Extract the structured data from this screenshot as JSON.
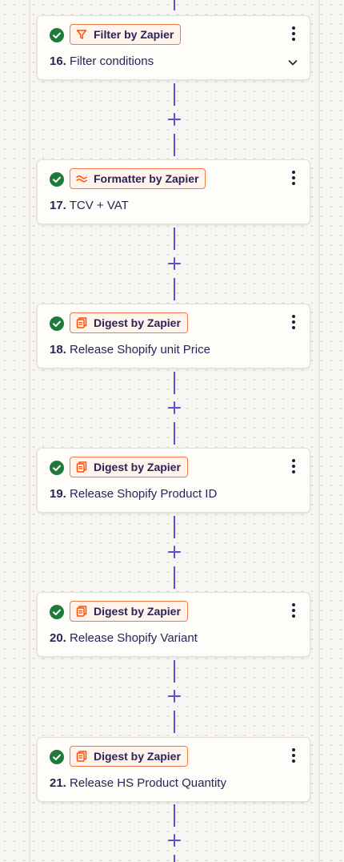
{
  "colors": {
    "connector": "#5c4fcf",
    "success": "#1f7a3a",
    "badge_border": "#f07a4a",
    "badge_bg": "#fff3ec",
    "text": "#2b2358"
  },
  "steps": [
    {
      "number": "16.",
      "title": "Filter conditions",
      "app": "Filter by Zapier",
      "app_icon": "filter-icon",
      "status": "success",
      "expandable": true
    },
    {
      "number": "17.",
      "title": "TCV + VAT",
      "app": "Formatter by Zapier",
      "app_icon": "formatter-icon",
      "status": "success",
      "expandable": false
    },
    {
      "number": "18.",
      "title": "Release Shopify unit Price",
      "app": "Digest by Zapier",
      "app_icon": "digest-icon",
      "status": "success",
      "expandable": false
    },
    {
      "number": "19.",
      "title": "Release Shopify Product ID",
      "app": "Digest by Zapier",
      "app_icon": "digest-icon",
      "status": "success",
      "expandable": false
    },
    {
      "number": "20.",
      "title": "Release Shopify Variant",
      "app": "Digest by Zapier",
      "app_icon": "digest-icon",
      "status": "success",
      "expandable": false
    },
    {
      "number": "21.",
      "title": "Release HS Product Quantity",
      "app": "Digest by Zapier",
      "app_icon": "digest-icon",
      "status": "success",
      "expandable": false
    }
  ]
}
